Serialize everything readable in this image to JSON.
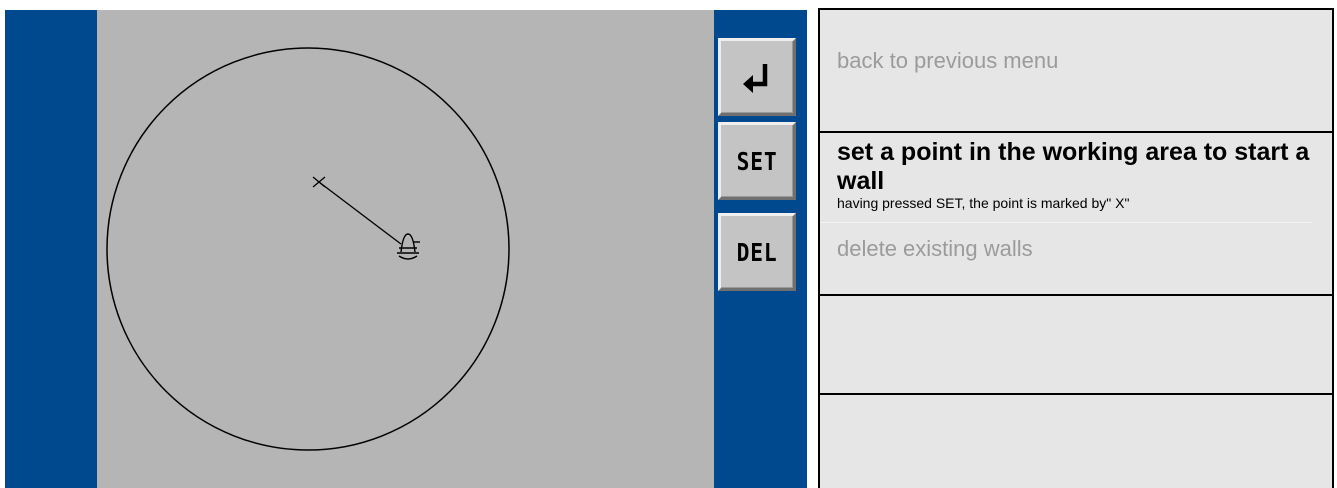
{
  "device": {
    "colors": {
      "frame": "#01498f",
      "work_area": "#b5b5b5",
      "button_face": "#c4c4c4"
    },
    "buttons": {
      "back_icon": "return-arrow-icon",
      "set_label": "SET",
      "del_label": "DEL"
    },
    "drawing": {
      "shapes": [
        "range-circle",
        "wall-start-point-x",
        "wall-line",
        "robot-icon"
      ]
    }
  },
  "descriptions": {
    "back": "back to previous menu",
    "set_title": "set a point in the working area to start a wall",
    "set_subtitle": "having pressed SET, the point is marked by\" X\"",
    "del": "delete existing walls",
    "empty_rows": 2
  }
}
